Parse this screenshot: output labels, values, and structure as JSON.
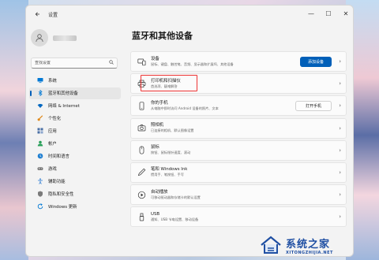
{
  "window": {
    "title": "设置"
  },
  "titlebar": {
    "back_icon": "back-arrow-icon",
    "minimize": "—",
    "maximize": "☐",
    "close": "✕"
  },
  "sidebar": {
    "search": {
      "placeholder": "查找设置"
    },
    "items": [
      {
        "label": "系统",
        "icon": "monitor-icon",
        "color": "#0078d4"
      },
      {
        "label": "蓝牙和其他设备",
        "icon": "bluetooth-icon",
        "color": "#0078d4",
        "active": true
      },
      {
        "label": "网络 & Internet",
        "icon": "wifi-icon",
        "color": "#0067c0"
      },
      {
        "label": "个性化",
        "icon": "brush-icon",
        "color": "#e08a1e"
      },
      {
        "label": "应用",
        "icon": "apps-icon",
        "color": "#4a6fa5"
      },
      {
        "label": "帐户",
        "icon": "person-icon",
        "color": "#2aa05a"
      },
      {
        "label": "时间和语言",
        "icon": "globe-clock-icon",
        "color": "#1f7fd1"
      },
      {
        "label": "游戏",
        "icon": "gamepad-icon",
        "color": "#777777"
      },
      {
        "label": "辅助功能",
        "icon": "accessibility-icon",
        "color": "#2a7ad1"
      },
      {
        "label": "隐私和安全性",
        "icon": "shield-icon",
        "color": "#7a7a7a"
      },
      {
        "label": "Windows 更新",
        "icon": "update-icon",
        "color": "#0078d4"
      }
    ]
  },
  "main": {
    "title": "蓝牙和其他设备",
    "cards": [
      {
        "name": "devices",
        "title": "设备",
        "sub": "鼠标、键盘、触控笔、音频、显示器和扩展坞、其他设备",
        "icon": "devices-icon",
        "button": "添加设备",
        "button_type": "primary"
      },
      {
        "name": "printers-scanners",
        "title": "打印机和扫描仪",
        "sub": "首选项、疑难解答",
        "icon": "printer-icon",
        "highlighted": true
      },
      {
        "name": "your-phone",
        "title": "你的手机",
        "sub": "从电脑中即时访问 Android 设备的照片、文本",
        "icon": "phone-icon",
        "button": "打开手机",
        "button_type": "secondary"
      },
      {
        "name": "cameras",
        "title": "照相机",
        "sub": "已连接的相机、默认图像设置",
        "icon": "camera-icon"
      },
      {
        "name": "mouse",
        "title": "鼠标",
        "sub": "按钮、鼠标指针速度、滚动",
        "icon": "mouse-icon"
      },
      {
        "name": "pen-windows-ink",
        "title": "笔和 Windows Ink",
        "sub": "惯用手、笔按钮、手写",
        "icon": "pen-icon"
      },
      {
        "name": "autoplay",
        "title": "自动播放",
        "sub": "可移动驱动器和存储卡的默认设置",
        "icon": "autoplay-icon"
      },
      {
        "name": "usb",
        "title": "USB",
        "sub": "通知、USB 节电设置、移动设备",
        "icon": "usb-icon"
      }
    ]
  },
  "watermark": {
    "main": "系统之家",
    "url": "XITONGZHIJIA.NET"
  }
}
